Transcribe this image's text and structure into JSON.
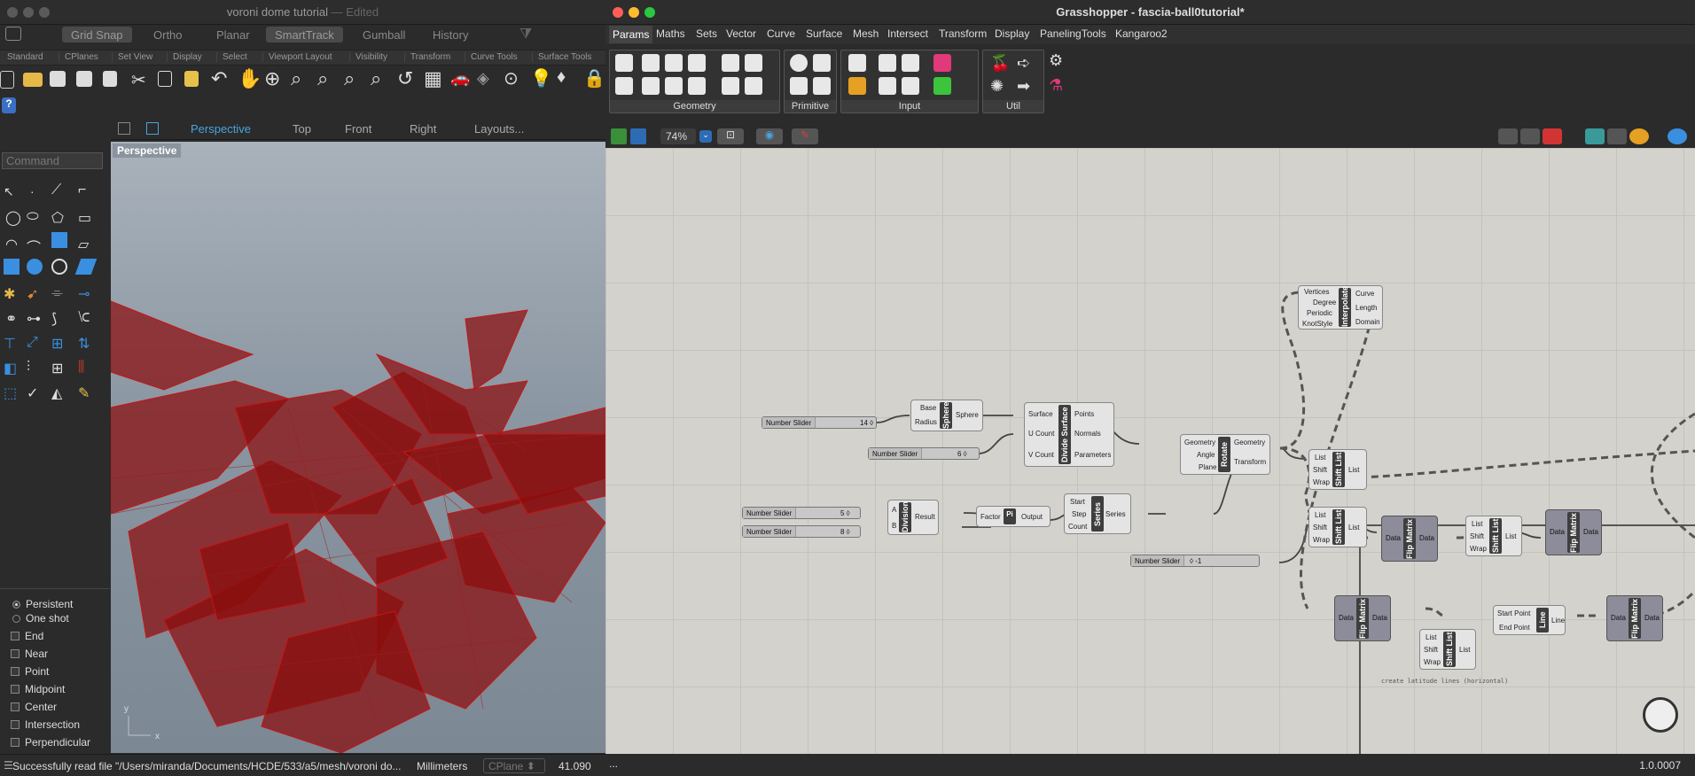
{
  "rhino": {
    "title": "voroni dome tutorial",
    "title_suffix": "— Edited",
    "modes": [
      "Grid Snap",
      "Ortho",
      "Planar",
      "SmartTrack",
      "Gumball",
      "History"
    ],
    "tabs": [
      "Standard",
      "CPlanes",
      "Set View",
      "Display",
      "Select",
      "Viewport Layout",
      "Visibility",
      "Transform",
      "Curve Tools",
      "Surface Tools"
    ],
    "viewtabs": [
      "Perspective",
      "Top",
      "Front",
      "Right",
      "Layouts..."
    ],
    "command_placeholder": "Command",
    "viewport_label": "Perspective",
    "osnap": {
      "persistent": "Persistent",
      "one_shot": "One shot",
      "items": [
        "End",
        "Near",
        "Point",
        "Midpoint",
        "Center",
        "Intersection",
        "Perpendicular"
      ]
    },
    "status": {
      "message": "Successfully read file \"/Users/miranda/Documents/HCDE/533/a5/mesh/voroni do...",
      "units": "Millimeters",
      "cplane": "CPlane",
      "coord": "41.090"
    }
  },
  "gh": {
    "title": "Grasshopper - fascia-ball0tutorial*",
    "menus": [
      "Params",
      "Maths",
      "Sets",
      "Vector",
      "Curve",
      "Surface",
      "Mesh",
      "Intersect",
      "Transform",
      "Display",
      "PanelingTools",
      "Kangaroo2"
    ],
    "groups": [
      "Geometry",
      "Primitive",
      "Input",
      "Util"
    ],
    "zoom": "74%",
    "status_left": "...",
    "version": "1.0.0007",
    "note": "create latitude lines (horizontal)",
    "sliders": [
      {
        "name": "Number Slider",
        "value": "14 ◊"
      },
      {
        "name": "Number Slider",
        "value": "6 ◊"
      },
      {
        "name": "Number Slider",
        "value": "5 ◊"
      },
      {
        "name": "Number Slider",
        "value": "8 ◊"
      },
      {
        "name": "Number Slider",
        "value": "◊ -1"
      }
    ],
    "components": {
      "sphere": {
        "label": "Sphere",
        "in": [
          "Base",
          "Radius"
        ],
        "out": [
          "Sphere"
        ]
      },
      "divide": {
        "label": "Divide Surface",
        "in": [
          "Surface",
          "U Count",
          "V Count"
        ],
        "out": [
          "Points",
          "Normals",
          "Parameters"
        ]
      },
      "rotate": {
        "label": "Rotate",
        "in": [
          "Geometry",
          "Angle",
          "Plane"
        ],
        "out": [
          "Geometry",
          "Transform"
        ]
      },
      "interp": {
        "label": "Interpolate",
        "in": [
          "Vertices",
          "Degree",
          "Periodic",
          "KnotStyle"
        ],
        "out": [
          "Curve",
          "Length",
          "Domain"
        ]
      },
      "division": {
        "label": "Division",
        "in": [
          "A",
          "B"
        ],
        "out": [
          "Result"
        ]
      },
      "pi": {
        "label": "Pi",
        "in": [
          "Factor"
        ],
        "out": [
          "Output"
        ]
      },
      "series": {
        "label": "Series",
        "in": [
          "Start",
          "Step",
          "Count"
        ],
        "out": [
          "Series"
        ]
      },
      "shift1": {
        "label": "Shift List",
        "in": [
          "List",
          "Shift",
          "Wrap"
        ],
        "out": [
          "List"
        ]
      },
      "shift2": {
        "label": "Shift List",
        "in": [
          "List",
          "Shift",
          "Wrap"
        ],
        "out": [
          "List"
        ]
      },
      "shift3": {
        "label": "Shift List",
        "in": [
          "List",
          "Shift",
          "Wrap"
        ],
        "out": [
          "List"
        ]
      },
      "shift4": {
        "label": "Shift List",
        "in": [
          "List",
          "Shift",
          "Wrap"
        ],
        "out": [
          "List"
        ]
      },
      "flip1": {
        "label": "Flip Matrix",
        "in": [
          "Data"
        ],
        "out": [
          "Data"
        ]
      },
      "flip2": {
        "label": "Flip Matrix",
        "in": [
          "Data"
        ],
        "out": [
          "Data"
        ]
      },
      "flip3": {
        "label": "Flip Matrix",
        "in": [
          "Data"
        ],
        "out": [
          "Data"
        ]
      },
      "flip4": {
        "label": "Flip Matrix",
        "in": [
          "Data"
        ],
        "out": [
          "Data"
        ]
      },
      "line": {
        "label": "Line",
        "in": [
          "Start Point",
          "End Point"
        ],
        "out": [
          "Line"
        ]
      }
    }
  }
}
